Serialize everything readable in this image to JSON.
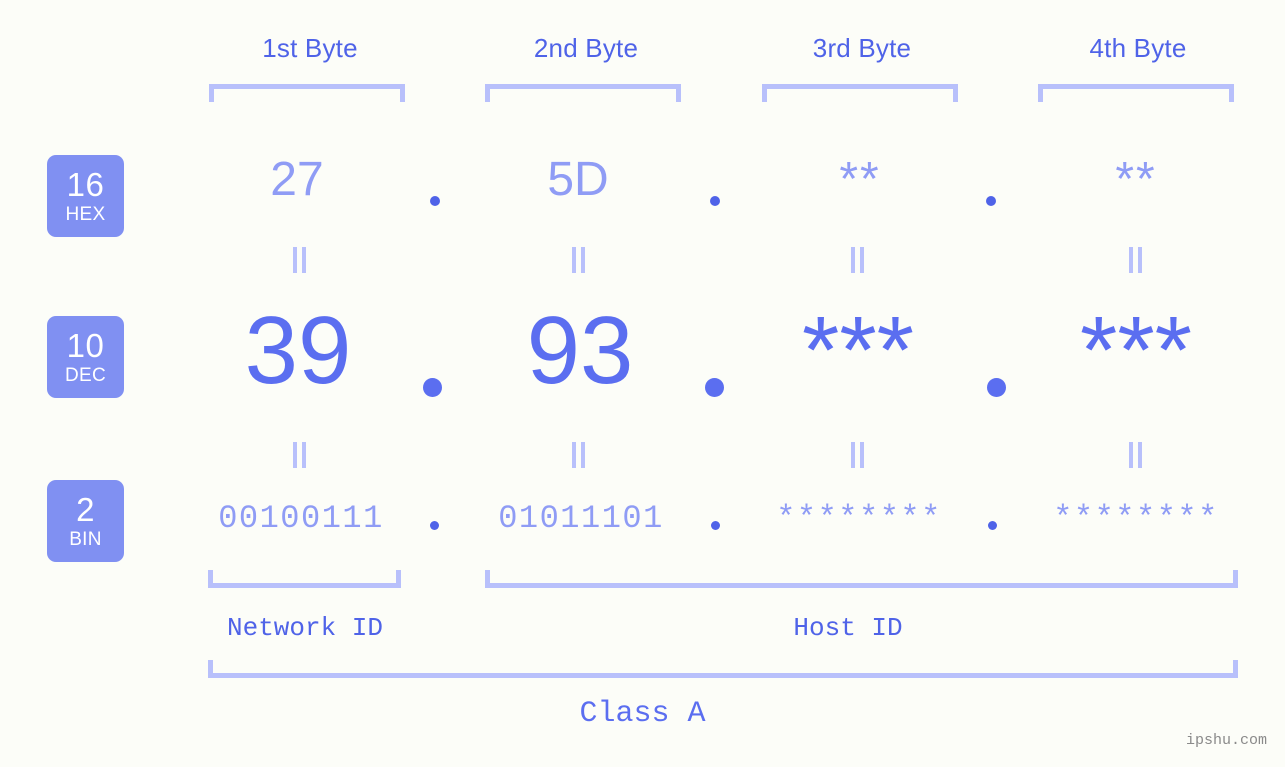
{
  "watermark": "ipshu.com",
  "columns": [
    {
      "header": "1st Byte"
    },
    {
      "header": "2nd Byte"
    },
    {
      "header": "3rd Byte"
    },
    {
      "header": "4th Byte"
    }
  ],
  "rows": [
    {
      "base": "16",
      "base_label": "HEX",
      "values": [
        "27",
        "5D",
        "**",
        "**"
      ],
      "separators": [
        ".",
        ".",
        "."
      ]
    },
    {
      "base": "10",
      "base_label": "DEC",
      "values": [
        "39",
        "93",
        "***",
        "***"
      ],
      "separators": [
        ".",
        ".",
        "."
      ]
    },
    {
      "base": "2",
      "base_label": "BIN",
      "values": [
        "00100111",
        "01011101",
        "********",
        "********"
      ],
      "separators": [
        ".",
        ".",
        "."
      ]
    }
  ],
  "equals_symbol": "=",
  "sections": [
    {
      "label": "Network ID"
    },
    {
      "label": "Host ID"
    }
  ],
  "class": {
    "label": "Class A"
  },
  "colors": {
    "background": "#fcfdf8",
    "accent_strong": "#4f63e8",
    "accent_mid": "#5b6ef0",
    "accent_light": "#8f9cf5",
    "accent_pale": "#b8c0fb",
    "badge_bg": "#8090f2",
    "badge_text": "#ffffff",
    "watermark_text": "#8a8a8a"
  }
}
